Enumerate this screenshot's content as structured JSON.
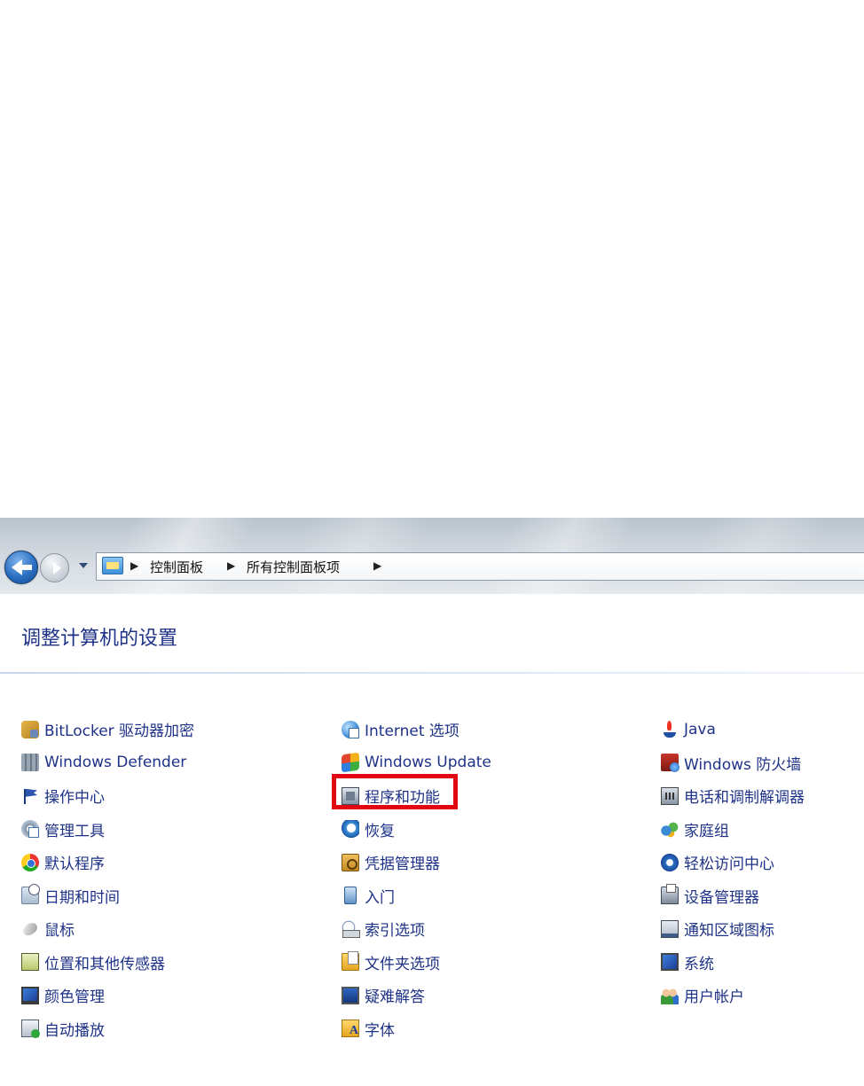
{
  "breadcrumb": {
    "items": [
      "控制面板",
      "所有控制面板项"
    ]
  },
  "page": {
    "title": "调整计算机的设置"
  },
  "columns": [
    [
      {
        "label": "BitLocker 驱动器加密",
        "icon": "bitlocker-icon"
      },
      {
        "label": "Windows Defender",
        "icon": "defender-icon"
      },
      {
        "label": "操作中心",
        "icon": "action-center-flag-icon"
      },
      {
        "label": "管理工具",
        "icon": "admin-tools-icon"
      },
      {
        "label": "默认程序",
        "icon": "default-programs-icon"
      },
      {
        "label": "日期和时间",
        "icon": "date-time-icon"
      },
      {
        "label": "鼠标",
        "icon": "mouse-icon"
      },
      {
        "label": "位置和其他传感器",
        "icon": "sensors-icon"
      },
      {
        "label": "颜色管理",
        "icon": "color-management-icon"
      },
      {
        "label": "自动播放",
        "icon": "autoplay-icon"
      }
    ],
    [
      {
        "label": "Internet 选项",
        "icon": "internet-options-icon"
      },
      {
        "label": "Windows Update",
        "icon": "windows-update-icon"
      },
      {
        "label": "程序和功能",
        "icon": "programs-features-icon",
        "highlighted": true
      },
      {
        "label": "恢复",
        "icon": "recovery-icon"
      },
      {
        "label": "凭据管理器",
        "icon": "credential-manager-icon"
      },
      {
        "label": "入门",
        "icon": "getting-started-icon"
      },
      {
        "label": "索引选项",
        "icon": "indexing-options-icon"
      },
      {
        "label": "文件夹选项",
        "icon": "folder-options-icon"
      },
      {
        "label": "疑难解答",
        "icon": "troubleshooting-icon"
      },
      {
        "label": "字体",
        "icon": "fonts-icon"
      }
    ],
    [
      {
        "label": "Java",
        "icon": "java-icon"
      },
      {
        "label": "Windows 防火墙",
        "icon": "firewall-icon"
      },
      {
        "label": "电话和调制解调器",
        "icon": "phone-modem-icon"
      },
      {
        "label": "家庭组",
        "icon": "homegroup-icon"
      },
      {
        "label": "轻松访问中心",
        "icon": "ease-of-access-icon"
      },
      {
        "label": "设备管理器",
        "icon": "device-manager-icon"
      },
      {
        "label": "通知区域图标",
        "icon": "notification-area-icon"
      },
      {
        "label": "系统",
        "icon": "system-icon"
      },
      {
        "label": "用户帐户",
        "icon": "user-accounts-icon"
      }
    ]
  ],
  "colors": {
    "link": "#1e3287",
    "highlight_box": "#e30613",
    "back_button": "#2a6fc2"
  }
}
